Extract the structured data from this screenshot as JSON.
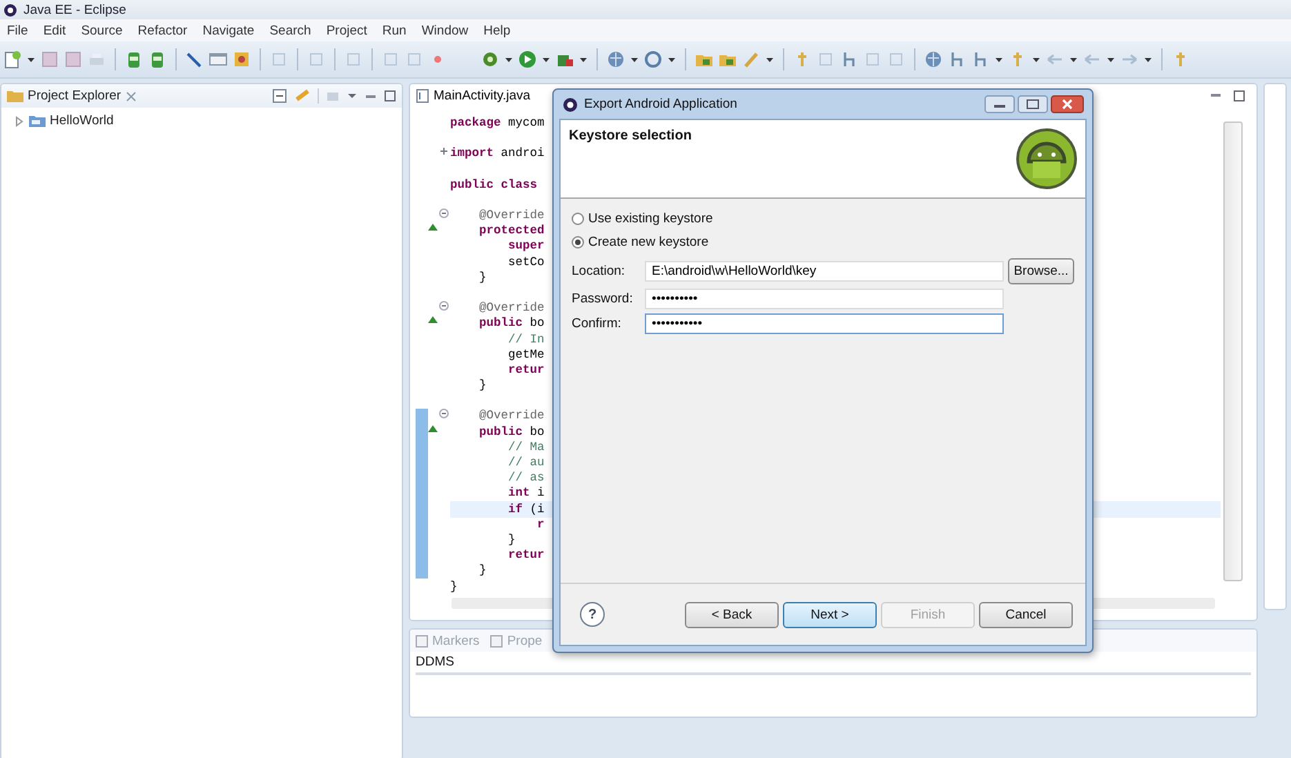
{
  "window": {
    "title": "Java EE - Eclipse"
  },
  "menu": [
    "File",
    "Edit",
    "Source",
    "Refactor",
    "Navigate",
    "Search",
    "Project",
    "Run",
    "Window",
    "Help"
  ],
  "project_explorer": {
    "title": "Project Explorer",
    "items": [
      {
        "label": "HelloWorld",
        "expanded": false
      }
    ]
  },
  "editor": {
    "tab": "MainActivity.java",
    "lines": [
      {
        "tokens": [
          {
            "text": "package",
            "kind": "keyword"
          },
          {
            "text": " mycom",
            "kind": "plain"
          }
        ]
      },
      {
        "blank_before": true,
        "folded": true,
        "tokens": [
          {
            "text": "import",
            "kind": "keyword"
          },
          {
            "text": " androi",
            "kind": "plain"
          }
        ]
      },
      {
        "blank_before": true,
        "tokens": [
          {
            "text": "public class",
            "kind": "keyword"
          }
        ]
      },
      {
        "blank_before": true,
        "folded": false,
        "tokens": [
          {
            "text": "    @Override",
            "kind": "annotation"
          }
        ]
      },
      {
        "override": true,
        "tokens": [
          {
            "text": "    protected",
            "kind": "keyword"
          }
        ]
      },
      {
        "tokens": [
          {
            "text": "        super",
            "kind": "keyword"
          }
        ]
      },
      {
        "tokens": [
          {
            "text": "        setCo",
            "kind": "plain"
          }
        ]
      },
      {
        "tokens": [
          {
            "text": "    }",
            "kind": "plain"
          }
        ]
      },
      {
        "blank_before": true,
        "folded": false,
        "tokens": [
          {
            "text": "    @Override",
            "kind": "annotation"
          }
        ]
      },
      {
        "override": true,
        "tokens": [
          {
            "text": "    public",
            "kind": "keyword"
          },
          {
            "text": " bo",
            "kind": "plain"
          }
        ]
      },
      {
        "tokens": [
          {
            "text": "        // In",
            "kind": "comment"
          }
        ]
      },
      {
        "tokens": [
          {
            "text": "        getMe",
            "kind": "plain"
          }
        ]
      },
      {
        "tokens": [
          {
            "text": "        retur",
            "kind": "keyword"
          }
        ]
      },
      {
        "tokens": [
          {
            "text": "    }",
            "kind": "plain"
          }
        ]
      },
      {
        "blank_before": true,
        "folded": false,
        "range": true,
        "tokens": [
          {
            "text": "    @Override",
            "kind": "annotation"
          }
        ]
      },
      {
        "override": true,
        "range": true,
        "tokens": [
          {
            "text": "    public",
            "kind": "keyword"
          },
          {
            "text": " bo",
            "kind": "plain"
          }
        ]
      },
      {
        "range": true,
        "tokens": [
          {
            "text": "        // Ma",
            "kind": "comment"
          }
        ]
      },
      {
        "range": true,
        "tokens": [
          {
            "text": "        // au",
            "kind": "comment"
          }
        ]
      },
      {
        "range": true,
        "tokens": [
          {
            "text": "        // as",
            "kind": "comment"
          }
        ]
      },
      {
        "range": true,
        "tokens": [
          {
            "text": "        int",
            "kind": "keyword"
          },
          {
            "text": " i",
            "kind": "plain"
          }
        ]
      },
      {
        "range": true,
        "current": true,
        "tokens": [
          {
            "text": "        if",
            "kind": "keyword"
          },
          {
            "text": " (i",
            "kind": "plain"
          }
        ]
      },
      {
        "range": true,
        "tokens": [
          {
            "text": "            r",
            "kind": "keyword"
          }
        ]
      },
      {
        "range": true,
        "tokens": [
          {
            "text": "        }",
            "kind": "plain"
          }
        ]
      },
      {
        "range": true,
        "tokens": [
          {
            "text": "        retur",
            "kind": "keyword"
          }
        ]
      },
      {
        "range": true,
        "tokens": [
          {
            "text": "    }",
            "kind": "plain"
          }
        ]
      },
      {
        "tokens": [
          {
            "text": "}",
            "kind": "plain"
          }
        ]
      }
    ]
  },
  "bottom_panel": {
    "tabs": [
      {
        "label": "Markers"
      },
      {
        "label": "Prope"
      }
    ],
    "view_title": "DDMS"
  },
  "dialog": {
    "title": "Export Android Application",
    "page_title": "Keystore selection",
    "options": [
      {
        "label": "Use existing keystore",
        "selected": false
      },
      {
        "label": "Create new keystore",
        "selected": true
      }
    ],
    "fields": [
      {
        "label": "Location:",
        "value": "E:\\android\\w\\HelloWorld\\key",
        "focused": false
      },
      {
        "label": "Password:",
        "value": "••••••••••",
        "focused": false
      },
      {
        "label": "Confirm:",
        "value": "•••••••••••",
        "focused": true
      }
    ],
    "browse_button": "Browse...",
    "help": "?",
    "buttons": [
      {
        "label": "< Back",
        "default": false,
        "disabled": false
      },
      {
        "label": "Next >",
        "default": true,
        "disabled": false
      },
      {
        "label": "Finish",
        "default": false,
        "disabled": true
      },
      {
        "label": "Cancel",
        "default": false,
        "disabled": false
      }
    ]
  }
}
